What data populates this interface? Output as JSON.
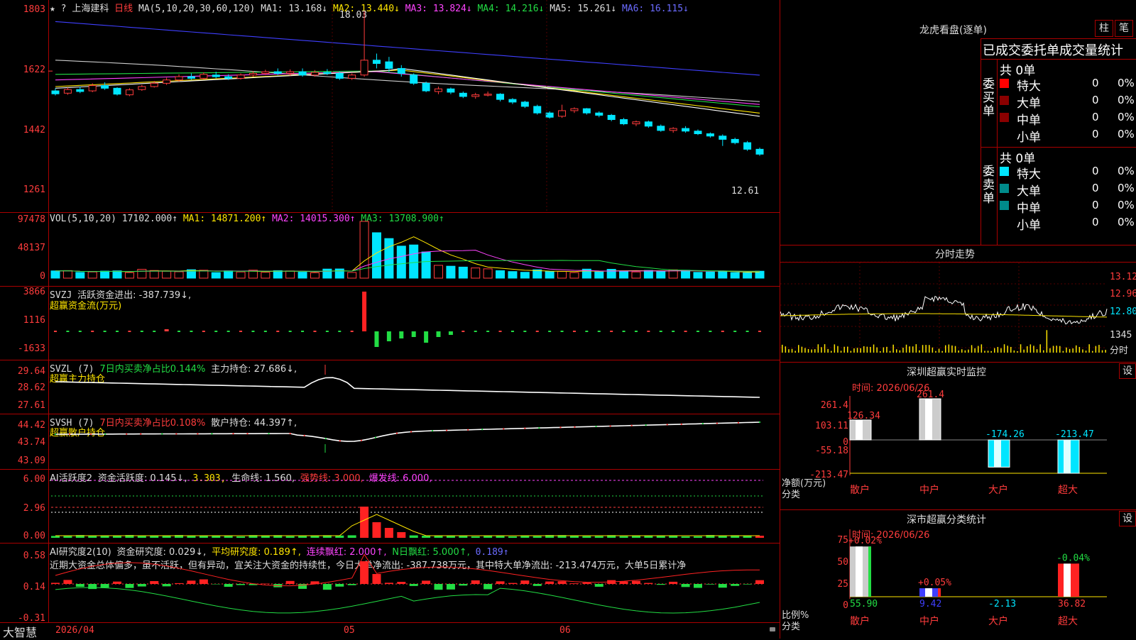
{
  "header": {
    "stars": "★ ?",
    "stock_name": "上海建科",
    "period": "日线",
    "ma_label": "MA(5,10,20,30,60,120)",
    "ma1": "MA1: 13.168↓",
    "ma2": "MA2: 13.440↓",
    "ma3": "MA3: 13.824↓",
    "ma4": "MA4: 14.216↓",
    "ma5": "MA5: 15.261↓",
    "ma6": "MA6: 16.115↓"
  },
  "price_panel": {
    "ticks": [
      "1803",
      "1622",
      "1442",
      "1261"
    ],
    "high_label": "18.03",
    "low_label": "12.61"
  },
  "vol_panel": {
    "title": "VOL(5,10,20)",
    "value": "17102.000↑",
    "ma1": "MA1: 14871.200↑",
    "ma2": "MA2: 14015.300↑",
    "ma3": "MA3: 13708.900↑",
    "ticks": [
      "97478",
      "48137",
      "0"
    ]
  },
  "svzj_panel": {
    "title": "SVZJ",
    "desc": "活跃资金进出: -387.739↓,",
    "sub": "超赢资金流(万元)",
    "ticks": [
      "3866",
      "1116",
      "-1633"
    ]
  },
  "svzl_panel": {
    "title": "SVZL (7)",
    "desc1": "7日内买卖净占比0.144%",
    "desc2": "主力持仓: 27.686↓,",
    "sub": "超赢主力持仓",
    "ticks": [
      "29.64",
      "28.62",
      "27.61"
    ]
  },
  "svsh_panel": {
    "title": "SVSH (7)",
    "desc1": "7日内买卖净占比0.108%",
    "desc2": "散户持仓: 44.397↑,",
    "sub": "超赢散户持仓",
    "ticks": [
      "44.42",
      "43.74",
      "43.09"
    ]
  },
  "ai_active_panel": {
    "title": "AI活跃度2",
    "desc1": "资金活跃度: 0.145↓,",
    "desc2": "3.303,",
    "desc3": "生命线: 1.560,",
    "desc4": "强势线: 3.000,",
    "desc5": "爆发线: 6.000,",
    "ticks": [
      "6.00",
      "2.96",
      "0.00"
    ]
  },
  "ai_research_panel": {
    "title": "AI研究度2(10)",
    "desc1": "资金研究度: 0.029↓,",
    "desc2": "平均研究度: 0.189↑,",
    "desc3": "连续飘红: 2.000↑,",
    "desc4": "N日飘红: 5.000↑,",
    "desc5": "0.189↑",
    "comment": "近期大资金总体偏多，虽不活跃，但有异动，宜关注大资金的持续性，今日大单净流出: -387.738万元，其中特大单净流出: -213.474万元，大单5日累计净",
    "ticks": [
      "0.58",
      "0.14",
      "-0.31"
    ]
  },
  "bottom_bar": {
    "brand": "大智慧",
    "dates": [
      "2026/04",
      "05",
      "06"
    ]
  },
  "right": {
    "lhb_title": "龙虎看盘(逐单)",
    "btn1": "柱",
    "btn2": "笔",
    "stats_title": "已成交委托单成交量统计",
    "buy_side_label": "委买单",
    "sell_side_label": "委卖单",
    "buy_total": "共 0单",
    "sell_total": "共 0单",
    "buy_rows": [
      {
        "name": "特大",
        "count": "0",
        "pct": "0%",
        "color": "#ff0000"
      },
      {
        "name": "大单",
        "count": "0",
        "pct": "0%",
        "color": "#8b0000"
      },
      {
        "name": "中单",
        "count": "0",
        "pct": "0%",
        "color": "#8b0000"
      },
      {
        "name": "小单",
        "count": "0",
        "pct": "0%",
        "color": "#000000"
      }
    ],
    "sell_rows": [
      {
        "name": "特大",
        "count": "0",
        "pct": "0%",
        "color": "#00e5ff"
      },
      {
        "name": "大单",
        "count": "0",
        "pct": "0%",
        "color": "#008b8b"
      },
      {
        "name": "中单",
        "count": "0",
        "pct": "0%",
        "color": "#008b8b"
      },
      {
        "name": "小单",
        "count": "0",
        "pct": "0%",
        "color": "#000000"
      }
    ],
    "intraday_title": "分时走势",
    "intraday_ticks": [
      "13.12",
      "12.96",
      "12.80"
    ],
    "intraday_vol": "1345",
    "intraday_vol_unit": "分时",
    "sz_title": "深圳超赢实时监控",
    "sz_btn": "设",
    "sz_time": "时间: 2026/06/26",
    "sz_ticks": [
      "261.4",
      "103.11",
      "0",
      "-55.18",
      "-213.47"
    ],
    "sz_values_labels": [
      "126.34",
      "261.4",
      "-174.26",
      "-213.47"
    ],
    "sz_axis_label": "净额(万元)",
    "sz_cat_label": "分类",
    "sz_categories": [
      "散户",
      "中户",
      "大户",
      "超大"
    ],
    "sm_title": "深市超赢分类统计",
    "sm_btn": "设",
    "sm_time": "时间: 2026/06/26",
    "sm_ticks": [
      "75",
      "50",
      "25",
      "0"
    ],
    "sm_axis_label": "比例%",
    "sm_cat_label": "分类",
    "sm_changes": [
      "+0.02%",
      "+0.05%",
      "",
      "-0.04%"
    ],
    "sm_values": [
      "55.90",
      "9.42",
      "-2.13",
      "36.82"
    ],
    "sm_categories": [
      "散户",
      "中户",
      "大户",
      "超大"
    ]
  },
  "chart_data": {
    "type": "candlestick",
    "price_range": [
      12.61,
      18.03
    ],
    "candles": [
      [
        15.62,
        15.53,
        15.7,
        15.48
      ],
      [
        15.55,
        15.66,
        15.72,
        15.5
      ],
      [
        15.66,
        15.6,
        15.75,
        15.55
      ],
      [
        15.62,
        15.78,
        15.85,
        15.58
      ],
      [
        15.78,
        15.7,
        15.88,
        15.65
      ],
      [
        15.7,
        15.52,
        15.73,
        15.48
      ],
      [
        15.5,
        15.65,
        15.7,
        15.46
      ],
      [
        15.66,
        15.75,
        15.8,
        15.62
      ],
      [
        15.75,
        15.85,
        15.92,
        15.72
      ],
      [
        15.85,
        15.95,
        16.02,
        15.8
      ],
      [
        15.95,
        16.05,
        16.12,
        15.9
      ],
      [
        16.05,
        16.0,
        16.15,
        15.95
      ],
      [
        16.0,
        16.12,
        16.18,
        15.96
      ],
      [
        16.1,
        16.05,
        16.2,
        16.0
      ],
      [
        16.05,
        16.0,
        16.12,
        15.95
      ],
      [
        16.0,
        16.1,
        16.15,
        15.96
      ],
      [
        16.1,
        16.15,
        16.22,
        16.05
      ],
      [
        16.15,
        16.2,
        16.26,
        16.1
      ],
      [
        16.2,
        16.15,
        16.3,
        16.1
      ],
      [
        16.15,
        16.2,
        16.27,
        16.08
      ],
      [
        16.2,
        16.1,
        16.3,
        16.05
      ],
      [
        16.1,
        16.18,
        16.25,
        16.05
      ],
      [
        16.18,
        16.15,
        16.28,
        16.1
      ],
      [
        16.15,
        16.0,
        16.2,
        15.95
      ],
      [
        16.0,
        16.1,
        16.15,
        15.95
      ],
      [
        16.1,
        16.55,
        18.03,
        16.05
      ],
      [
        16.55,
        16.45,
        16.75,
        16.3
      ],
      [
        16.5,
        16.3,
        16.65,
        16.2
      ],
      [
        16.3,
        16.15,
        16.4,
        16.05
      ],
      [
        16.1,
        15.85,
        16.15,
        15.8
      ],
      [
        15.85,
        15.62,
        15.9,
        15.58
      ],
      [
        15.6,
        15.68,
        15.75,
        15.52
      ],
      [
        15.68,
        15.58,
        15.72,
        15.52
      ],
      [
        15.55,
        15.45,
        15.6,
        15.4
      ],
      [
        15.45,
        15.5,
        15.56,
        15.38
      ],
      [
        15.5,
        15.52,
        15.6,
        15.45
      ],
      [
        15.52,
        15.36,
        15.55,
        15.3
      ],
      [
        15.36,
        15.28,
        15.4,
        15.22
      ],
      [
        15.28,
        15.15,
        15.32,
        15.1
      ],
      [
        15.15,
        14.95,
        15.2,
        14.9
      ],
      [
        14.95,
        14.82,
        15.0,
        14.78
      ],
      [
        14.85,
        15.02,
        15.2,
        14.8
      ],
      [
        15.02,
        15.08,
        15.12,
        14.95
      ],
      [
        15.08,
        14.95,
        15.1,
        14.9
      ],
      [
        14.95,
        14.88,
        15.0,
        14.82
      ],
      [
        14.88,
        14.75,
        14.92,
        14.7
      ],
      [
        14.75,
        14.62,
        14.8,
        14.58
      ],
      [
        14.62,
        14.68,
        14.72,
        14.55
      ],
      [
        14.68,
        14.55,
        14.72,
        14.5
      ],
      [
        14.55,
        14.42,
        14.6,
        14.38
      ],
      [
        14.42,
        14.48,
        14.52,
        14.35
      ],
      [
        14.48,
        14.4,
        14.55,
        14.35
      ],
      [
        14.4,
        14.32,
        14.45,
        14.28
      ],
      [
        14.32,
        14.25,
        14.36,
        14.2
      ],
      [
        14.25,
        14.15,
        14.3,
        13.95
      ],
      [
        14.15,
        14.05,
        14.2,
        14.0
      ],
      [
        14.05,
        13.85,
        14.1,
        13.8
      ],
      [
        13.85,
        13.7,
        13.9,
        13.65
      ]
    ],
    "ma_series_values": {
      "MA1": 13.168,
      "MA2": 13.44,
      "MA3": 13.824,
      "MA4": 14.216,
      "MA5": 15.261,
      "MA6": 16.115
    }
  },
  "colors": {
    "up": "#ff3c3c",
    "down": "#00e5ff",
    "grid": "#aa0000",
    "axis_text": "#ff3c3c"
  }
}
